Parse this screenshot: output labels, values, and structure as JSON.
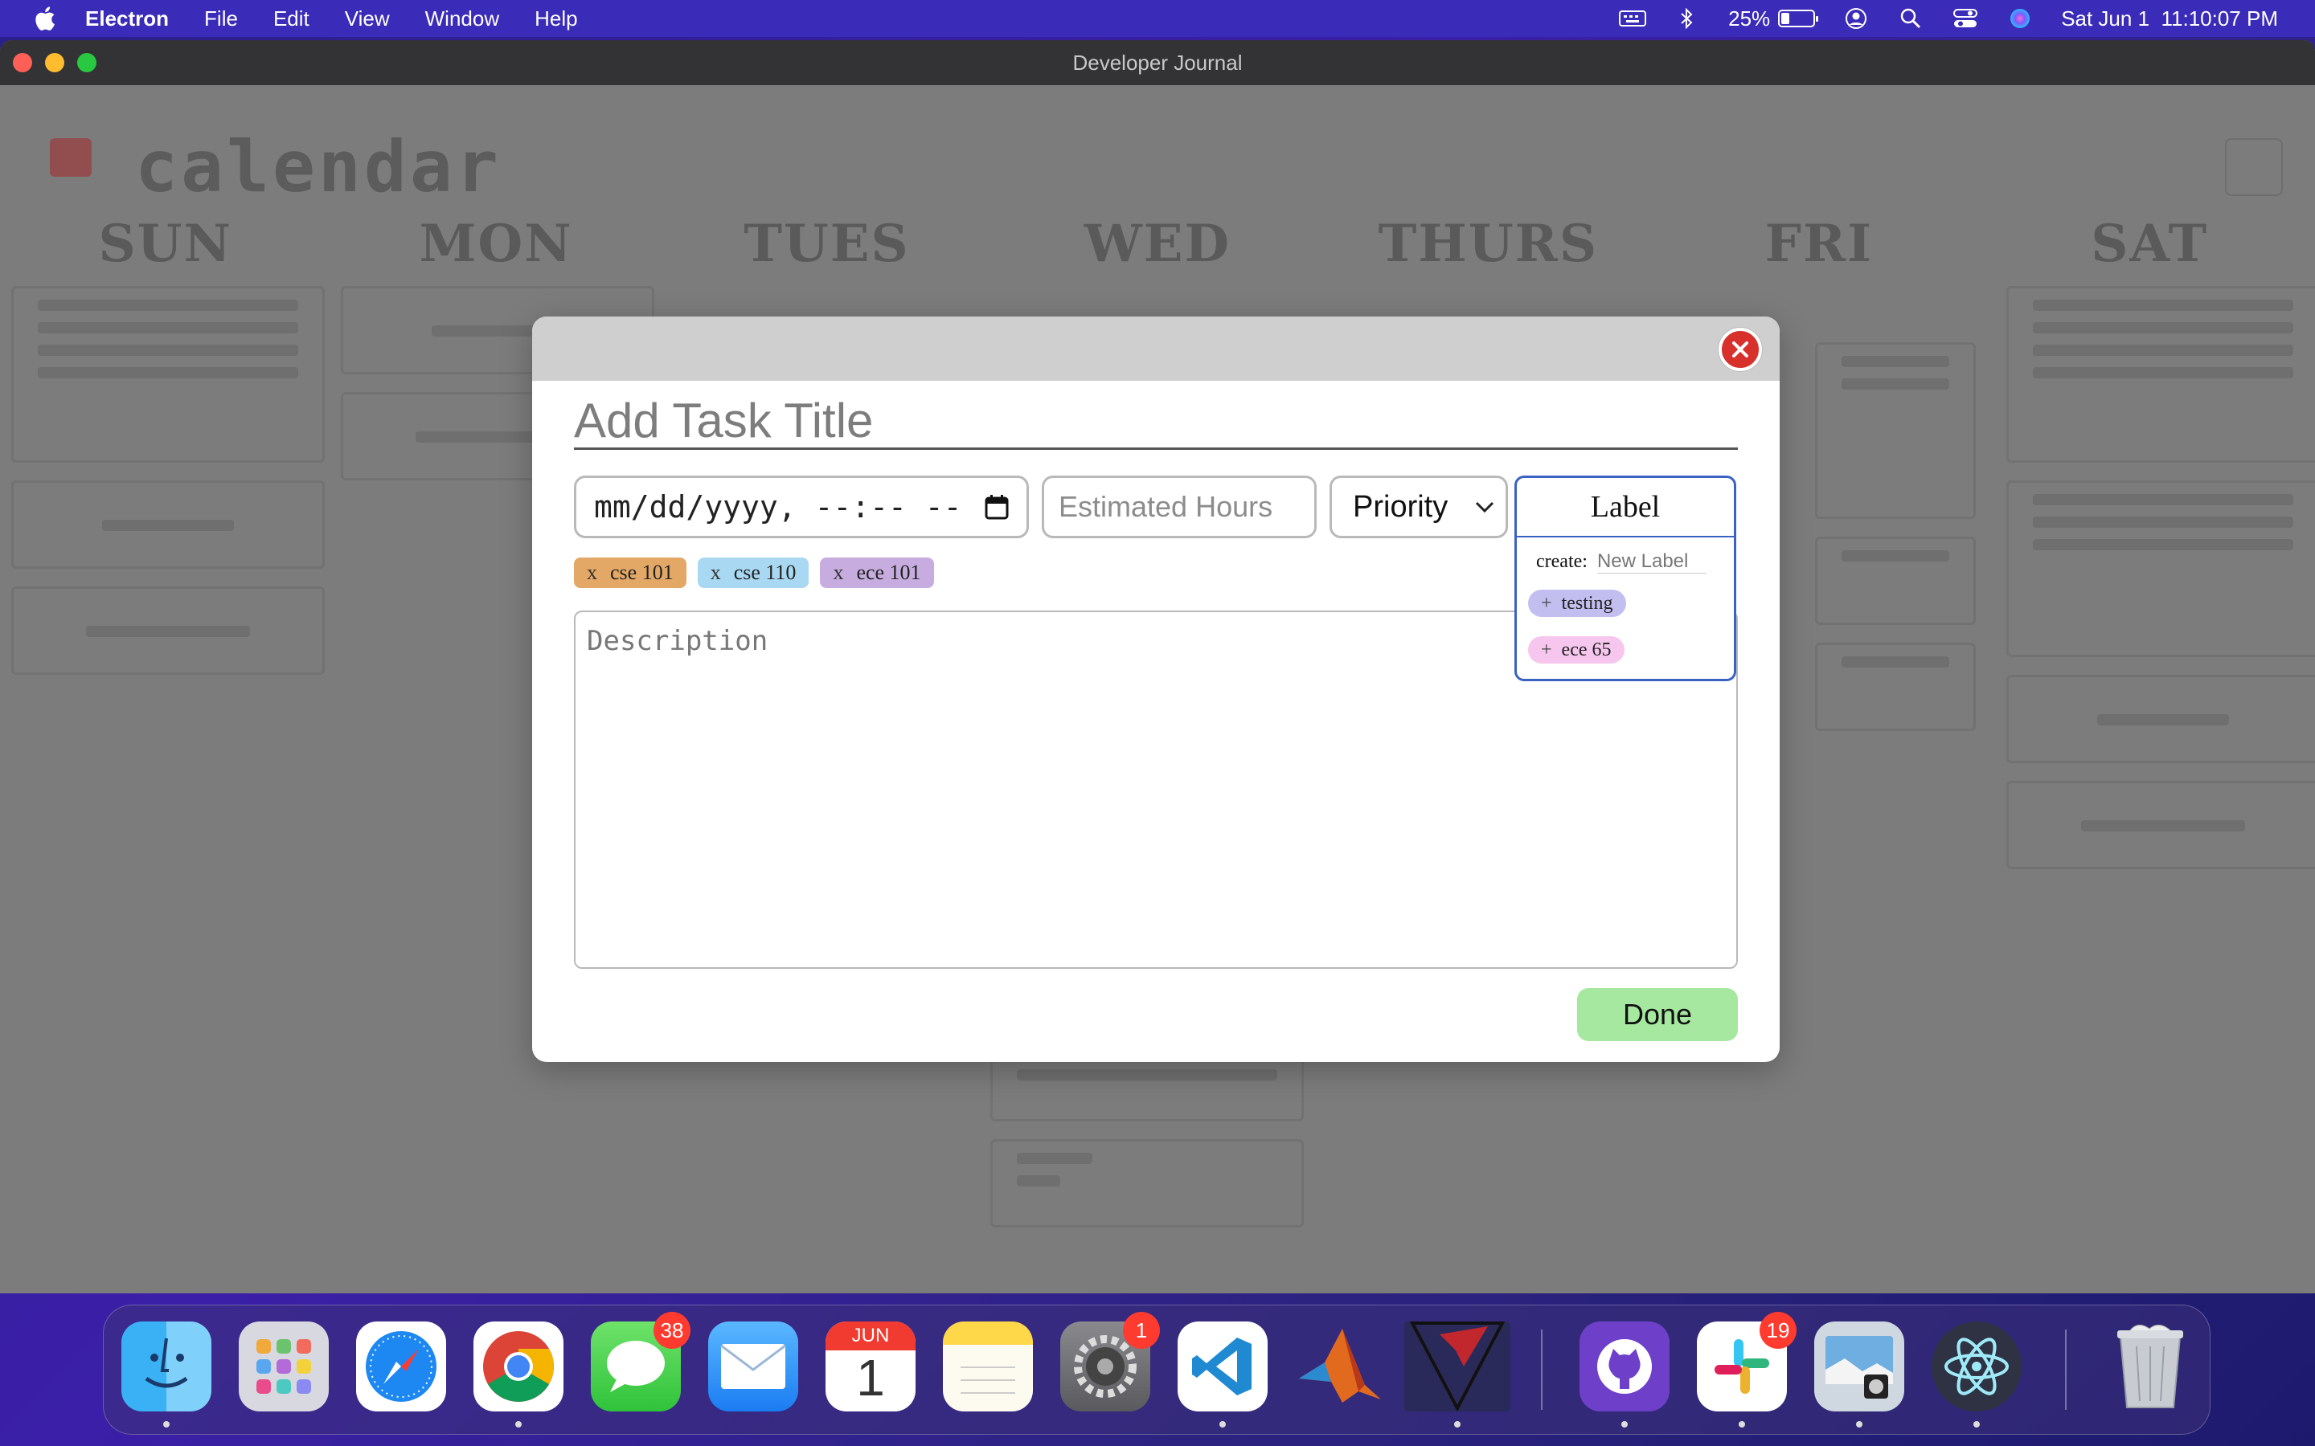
{
  "menubar": {
    "app_name": "Electron",
    "items": [
      "File",
      "Edit",
      "View",
      "Window",
      "Help"
    ],
    "battery_percent": "25%",
    "battery_level": 0.25,
    "datetime": "Sat Jun 1  11:10:07 PM"
  },
  "window": {
    "title": "Developer Journal"
  },
  "calendar": {
    "title": "calendar",
    "days": [
      "SUN",
      "MON",
      "TUES",
      "WED",
      "THURS",
      "FRI",
      "SAT"
    ]
  },
  "modal": {
    "title_placeholder": "Add Task Title",
    "date_placeholder": "mm/dd/yyyy, --:-- --",
    "hours_placeholder": "Estimated Hours",
    "priority_value": "Priority",
    "label_header": "Label",
    "create_label": "create:",
    "new_label_placeholder": "New Label",
    "label_options": [
      {
        "name": "testing",
        "color": "#c2bff0"
      },
      {
        "name": "ece 65",
        "color": "#f6c6ee"
      }
    ],
    "selected_labels": [
      {
        "name": "cse 101",
        "color": "#e3a866"
      },
      {
        "name": "cse 110",
        "color": "#a9d8f2"
      },
      {
        "name": "ece 101",
        "color": "#c7addf"
      }
    ],
    "description_placeholder": "Description",
    "done_label": "Done",
    "remove_symbol": "x",
    "add_symbol": "+"
  },
  "dock": {
    "apps": [
      {
        "name": "Finder",
        "badge": ""
      },
      {
        "name": "Launchpad",
        "badge": ""
      },
      {
        "name": "Safari",
        "badge": ""
      },
      {
        "name": "Chrome",
        "badge": ""
      },
      {
        "name": "Messages",
        "badge": "38"
      },
      {
        "name": "Mail",
        "badge": ""
      },
      {
        "name": "Calendar",
        "badge": "",
        "month": "JUN",
        "day": "1"
      },
      {
        "name": "Notes",
        "badge": ""
      },
      {
        "name": "System Settings",
        "badge": "1"
      },
      {
        "name": "VS Code",
        "badge": ""
      },
      {
        "name": "MATLAB",
        "badge": ""
      },
      {
        "name": "Quartus",
        "badge": ""
      },
      {
        "name": "GitHub Desktop",
        "badge": ""
      },
      {
        "name": "Slack",
        "badge": "19"
      },
      {
        "name": "Preview",
        "badge": ""
      },
      {
        "name": "Electron",
        "badge": ""
      },
      {
        "name": "Trash",
        "badge": ""
      }
    ]
  },
  "colors": {
    "accent_blue": "#3a62c2",
    "done_green": "#a6e8a0",
    "close_red": "#d8302b"
  }
}
